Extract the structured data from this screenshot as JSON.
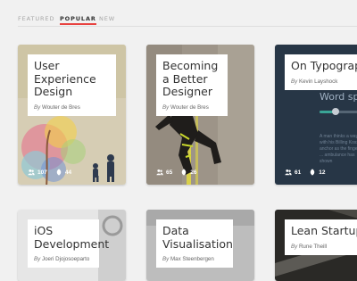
{
  "tabs": [
    {
      "label": "FEATURED"
    },
    {
      "label": "POPULAR"
    },
    {
      "label": "NEW"
    }
  ],
  "cards": [
    {
      "title": "User Experience Design",
      "by": "By",
      "author": "Wouter de Bres",
      "followers": "107",
      "reads": "44"
    },
    {
      "title": "Becoming a Better Designer",
      "by": "By",
      "author": "Wouter de Bres",
      "followers": "65",
      "reads": "26"
    },
    {
      "title": "On Typography",
      "by": "By",
      "author": "Kevin Layshock",
      "followers": "61",
      "reads": "12",
      "art_text": "Word sp",
      "art_paragraph": "A man thinks a way with his Billing Kosse anchor as the fingers ... ambulance has shown"
    },
    {
      "title": "iOS Development",
      "by": "By",
      "author": "Joeri Djojosoeparto"
    },
    {
      "title": "Data Visualisation",
      "by": "By",
      "author": "Max Steenbergen"
    },
    {
      "title": "Lean Startup",
      "by": "By",
      "author": "Rune Theill"
    }
  ],
  "colors": {
    "accent": "#e8423f",
    "page_bg": "#f1f1f1"
  }
}
